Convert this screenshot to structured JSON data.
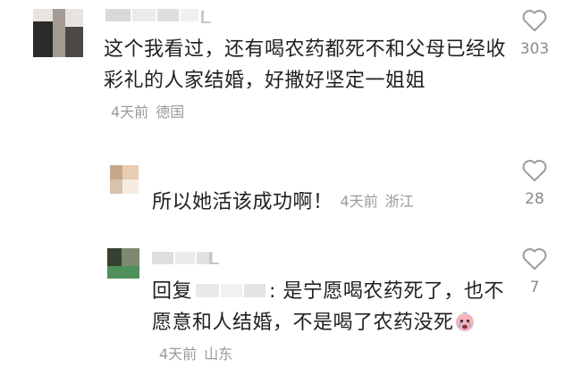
{
  "comments": [
    {
      "text": "这个我看过，还有喝农药都死不和父母已经收彩礼的人家结婚，好撒好坚定一姐姐",
      "time": "4天前",
      "location": "德国",
      "likes": "303"
    },
    {
      "text": "所以她活该成功啊！",
      "time": "4天前",
      "location": "浙江",
      "likes": "28"
    },
    {
      "text_prefix": "回复",
      "text_suffix": ": 是宁愿喝农药死了，也不愿意和人结婚，不是喝了农药没死",
      "time": "4天前",
      "location": "山东",
      "likes": "7",
      "emoji": "crying-face-emoji"
    }
  ],
  "colors": {
    "text": "#1f1f1f",
    "meta": "#9a9a9a",
    "like_count": "#8a8a8a",
    "heart_outline": "#9a9a9a"
  },
  "icons": {
    "like": "heart-outline-icon"
  }
}
